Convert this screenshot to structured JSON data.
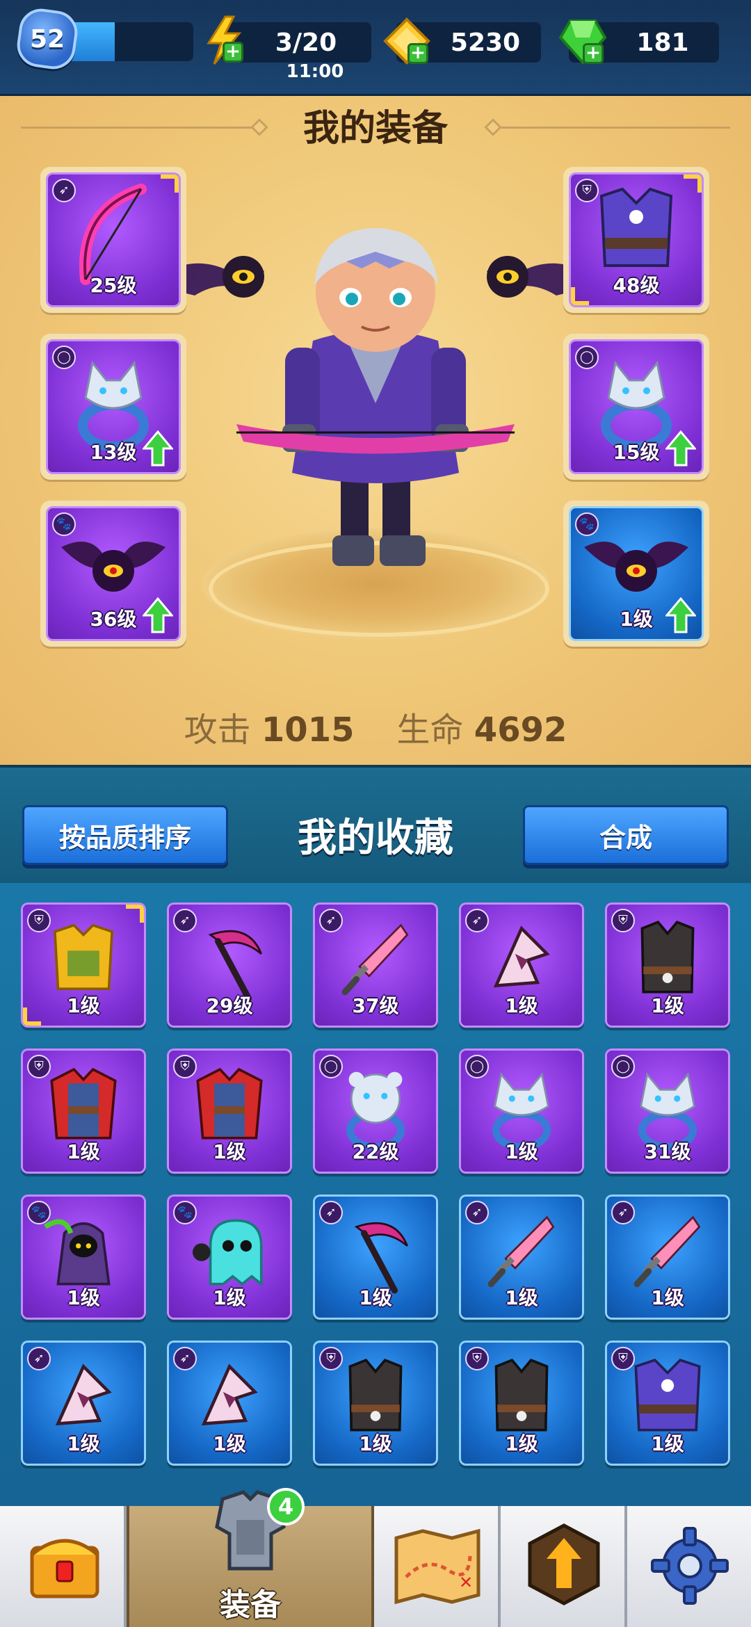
{
  "topbar": {
    "level": "52",
    "xp_progress": 0.38,
    "energy": "3/20",
    "energy_timer": "11:00",
    "coins": "5230",
    "gems": "181"
  },
  "equipment": {
    "title": "我的装备",
    "slots": [
      {
        "type": "bow",
        "level": "25级",
        "rarity": "purple",
        "upgrade": false
      },
      {
        "type": "ring",
        "level": "13级",
        "rarity": "purple",
        "upgrade": true
      },
      {
        "type": "pet",
        "level": "36级",
        "rarity": "purple",
        "upgrade": true
      },
      {
        "type": "armor",
        "level": "48级",
        "rarity": "purple",
        "upgrade": false
      },
      {
        "type": "ring",
        "level": "15级",
        "rarity": "purple",
        "upgrade": true
      },
      {
        "type": "pet",
        "level": "1级",
        "rarity": "blue",
        "upgrade": true
      }
    ],
    "attack_label": "攻击",
    "attack_value": "1015",
    "hp_label": "生命",
    "hp_value": "4692"
  },
  "collection": {
    "title": "我的收藏",
    "sort_button": "按品质排序",
    "merge_button": "合成",
    "items": [
      {
        "icon": "gold-armor",
        "level": "1级",
        "rarity": "purple"
      },
      {
        "icon": "scythe",
        "level": "29级",
        "rarity": "purple"
      },
      {
        "icon": "sword",
        "level": "37级",
        "rarity": "purple"
      },
      {
        "icon": "shuriken",
        "level": "1级",
        "rarity": "purple"
      },
      {
        "icon": "vest",
        "level": "1级",
        "rarity": "purple"
      },
      {
        "icon": "cape-armor",
        "level": "1级",
        "rarity": "purple"
      },
      {
        "icon": "cape-armor",
        "level": "1级",
        "rarity": "purple"
      },
      {
        "icon": "bear-ring",
        "level": "22级",
        "rarity": "purple"
      },
      {
        "icon": "wolf-ring",
        "level": "1级",
        "rarity": "purple"
      },
      {
        "icon": "wolf-ring",
        "level": "31级",
        "rarity": "purple"
      },
      {
        "icon": "reaper-pet",
        "level": "1级",
        "rarity": "purple"
      },
      {
        "icon": "ghost-pet",
        "level": "1级",
        "rarity": "purple"
      },
      {
        "icon": "scythe",
        "level": "1级",
        "rarity": "blue"
      },
      {
        "icon": "sword",
        "level": "1级",
        "rarity": "blue"
      },
      {
        "icon": "sword",
        "level": "1级",
        "rarity": "blue"
      },
      {
        "icon": "shuriken",
        "level": "1级",
        "rarity": "blue"
      },
      {
        "icon": "shuriken",
        "level": "1级",
        "rarity": "blue"
      },
      {
        "icon": "vest",
        "level": "1级",
        "rarity": "blue"
      },
      {
        "icon": "vest",
        "level": "1级",
        "rarity": "blue"
      },
      {
        "icon": "robe-armor",
        "level": "1级",
        "rarity": "blue"
      }
    ]
  },
  "nav": {
    "items": [
      {
        "name": "chest-icon",
        "label": ""
      },
      {
        "name": "armor-icon",
        "label": "装备",
        "badge": "4"
      },
      {
        "name": "map-icon",
        "label": ""
      },
      {
        "name": "upgrade-icon",
        "label": ""
      },
      {
        "name": "gear-icon",
        "label": ""
      }
    ]
  },
  "colors": {
    "purple_rarity": "#7d2fd3",
    "blue_rarity": "#1466c4",
    "panel_gold": "#efc777",
    "collection_blue": "#1a78a8",
    "upgrade_green": "#3ccf3f"
  }
}
